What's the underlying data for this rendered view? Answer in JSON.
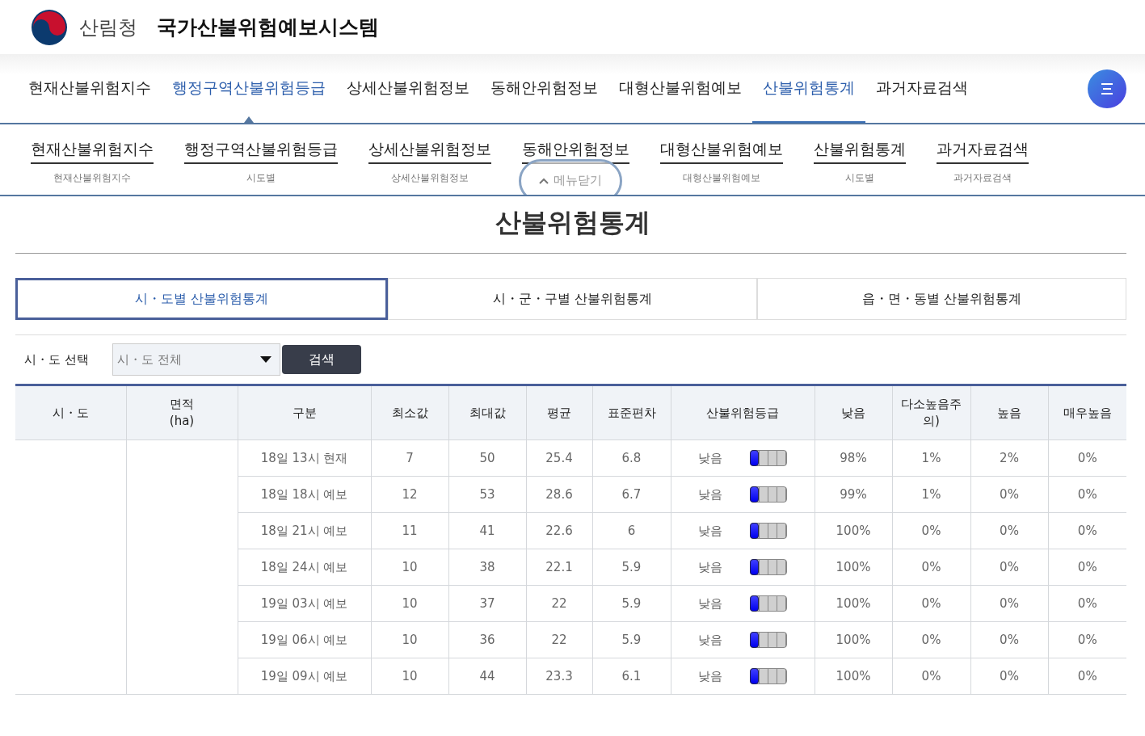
{
  "header": {
    "agency": "산림청",
    "system_title": "국가산불위험예보시스템"
  },
  "main_nav": [
    {
      "label": "현재산불위험지수",
      "selected": false,
      "pointed": false
    },
    {
      "label": "행정구역산불위험등급",
      "selected": false,
      "pointed": true
    },
    {
      "label": "상세산불위험정보",
      "selected": false,
      "pointed": false
    },
    {
      "label": "동해안위험정보",
      "selected": false,
      "pointed": false
    },
    {
      "label": "대형산불위험예보",
      "selected": false,
      "pointed": false
    },
    {
      "label": "산불위험통계",
      "selected": true,
      "pointed": false
    },
    {
      "label": "과거자료검색",
      "selected": false,
      "pointed": false
    }
  ],
  "submenu": [
    {
      "label": "현재산불위험지수",
      "items": [
        "현재산불위험지수"
      ]
    },
    {
      "label": "행정구역산불위험등급",
      "items": [
        "시도별"
      ]
    },
    {
      "label": "상세산불위험정보",
      "items": [
        "상세산불위험정보"
      ]
    },
    {
      "label": "동해안위험정보"
    },
    {
      "label": "대형산불위험예보",
      "items": [
        "대형산불위험예보"
      ]
    },
    {
      "label": "산불위험통계",
      "items": [
        "시도별"
      ]
    },
    {
      "label": "과거자료검색",
      "items": [
        "과거자료검색"
      ]
    }
  ],
  "close_menu": "메뉴닫기",
  "page_title": "산불위험통계",
  "tabs": [
    {
      "label": "시・도별 산불위험통계",
      "selected": true
    },
    {
      "label": "시・군・구별 산불위험통계",
      "selected": false
    },
    {
      "label": "읍・면・동별 산불위험통계",
      "selected": false
    }
  ],
  "filter": {
    "label": "시・도 선택",
    "value": "시・도 전체",
    "button": "검색"
  },
  "table": {
    "columns": [
      "시・도",
      "면적\n(ha)",
      "구분",
      "최소값",
      "최대값",
      "평균",
      "표준편차",
      "산불위험등급",
      "낮음",
      "다소높음주의)",
      "높음",
      "매우높음"
    ],
    "rows": [
      {
        "period": "18일 13시 현재",
        "min": "7",
        "max": "50",
        "mean": "25.4",
        "std": "6.8",
        "grade": "낮음",
        "level": 0.25,
        "low": "98%",
        "moderate": "1%",
        "high": "2%",
        "very_high": "0%"
      },
      {
        "period": "18일 18시 예보",
        "min": "12",
        "max": "53",
        "mean": "28.6",
        "std": "6.7",
        "grade": "낮음",
        "level": 0.25,
        "low": "99%",
        "moderate": "1%",
        "high": "0%",
        "very_high": "0%"
      },
      {
        "period": "18일 21시 예보",
        "min": "11",
        "max": "41",
        "mean": "22.6",
        "std": "6",
        "grade": "낮음",
        "level": 0.25,
        "low": "100%",
        "moderate": "0%",
        "high": "0%",
        "very_high": "0%"
      },
      {
        "period": "18일 24시 예보",
        "min": "10",
        "max": "38",
        "mean": "22.1",
        "std": "5.9",
        "grade": "낮음",
        "level": 0.25,
        "low": "100%",
        "moderate": "0%",
        "high": "0%",
        "very_high": "0%"
      },
      {
        "period": "19일 03시 예보",
        "min": "10",
        "max": "37",
        "mean": "22",
        "std": "5.9",
        "grade": "낮음",
        "level": 0.25,
        "low": "100%",
        "moderate": "0%",
        "high": "0%",
        "very_high": "0%"
      },
      {
        "period": "19일 06시 예보",
        "min": "10",
        "max": "36",
        "mean": "22",
        "std": "5.9",
        "grade": "낮음",
        "level": 0.25,
        "low": "100%",
        "moderate": "0%",
        "high": "0%",
        "very_high": "0%"
      },
      {
        "period": "19일 09시 예보",
        "min": "10",
        "max": "44",
        "mean": "23.3",
        "std": "6.1",
        "grade": "낮음",
        "level": 0.25,
        "low": "100%",
        "moderate": "0%",
        "high": "0%",
        "very_high": "0%"
      }
    ]
  }
}
